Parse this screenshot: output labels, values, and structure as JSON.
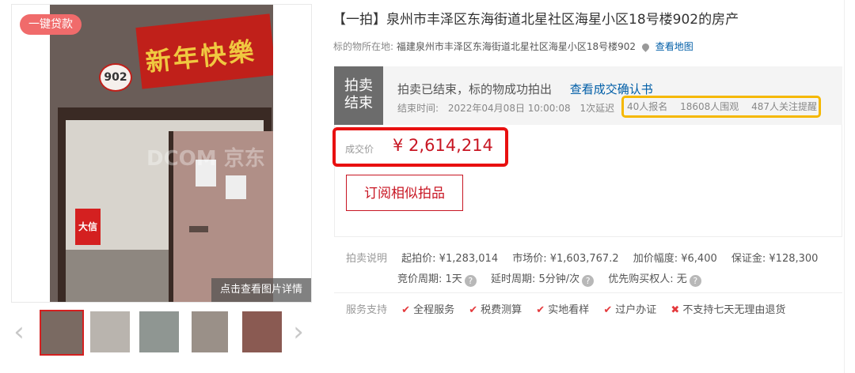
{
  "gallery": {
    "loan_badge": "一键贷款",
    "photo_detail_label": "点击查看图片详情",
    "banner_text": "新年快樂",
    "unit_plate": "902",
    "watermark": "DCOM 京东",
    "sign_text": "大信",
    "prev_icon": "chevron-left-icon",
    "next_icon": "chevron-right-icon"
  },
  "item": {
    "title": "【一拍】泉州市丰泽区东海街道北星社区海星小区18号楼902的房产",
    "location_label": "标的物所在地:",
    "location_value": "福建泉州市丰泽区东海街道北星社区海星小区18号楼902",
    "map_link": "查看地图"
  },
  "status": {
    "tag": "拍卖结束",
    "tag_line1": "拍卖",
    "tag_line2": "结束",
    "message": "拍卖已结束，标的物成功拍出",
    "confirm_link": "查看成交确认书",
    "end_time_label": "结束时间:",
    "end_time": "2022年04月08日 10:00:08",
    "delay": "1次延迟",
    "signups": "40人报名",
    "views": "18608人围观",
    "followers": "487人关注提醒",
    "highlight_color": "#f5b800"
  },
  "price": {
    "label": "成交价",
    "value": "¥ 2,614,214",
    "highlight_color": "#e81010",
    "subscribe_button": "订阅相似拍品"
  },
  "auction_info": {
    "label": "拍卖说明",
    "start_price": "起拍价: ¥1,283,014",
    "market_price": "市场价: ¥1,603,767.2",
    "increment": "加价幅度: ¥6,400",
    "deposit": "保证金: ¥128,300",
    "bid_period": "竞价周期: 1天",
    "delay_period": "延时周期: 5分钟/次",
    "priority": "优先购买权人: 无"
  },
  "services": {
    "label": "服务支持",
    "items": [
      "全程服务",
      "税费测算",
      "实地看样",
      "过户办证"
    ],
    "not_supported": "不支持七天无理由退货"
  },
  "colors": {
    "accent_red": "#c81623",
    "link_blue": "#005ea7",
    "status_gray": "#6c6c6c"
  }
}
